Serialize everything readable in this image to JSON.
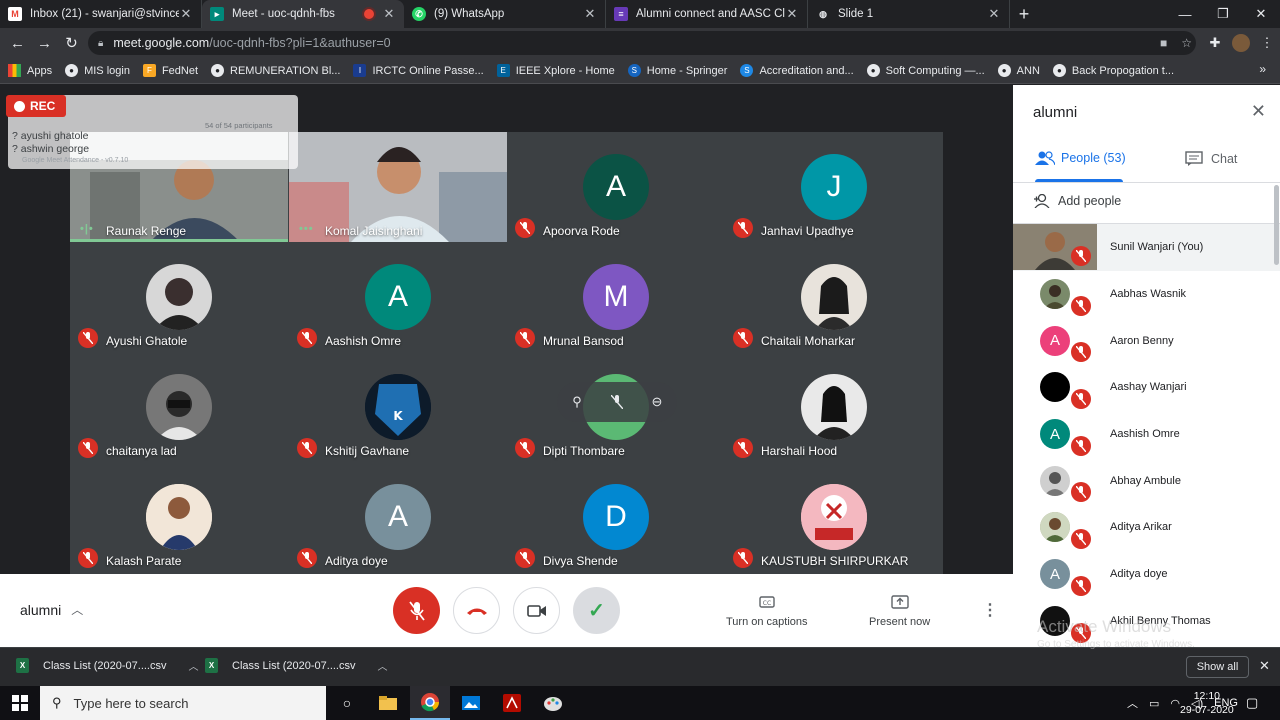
{
  "browser": {
    "tabs": [
      {
        "title": "Inbox (21) - swanjari@stvincentn",
        "icon": "gmail-icon",
        "active": false
      },
      {
        "title": "Meet - uoc-qdnh-fbs",
        "icon": "meet-icon",
        "active": true,
        "recording": true
      },
      {
        "title": "(9) WhatsApp",
        "icon": "whatsapp-icon",
        "active": false
      },
      {
        "title": "Alumni connect and AASC Club",
        "icon": "forms-icon",
        "active": false
      },
      {
        "title": "Slide 1",
        "icon": "globe-icon",
        "active": false
      }
    ],
    "url_host": "meet.google.com",
    "url_path": "/uoc-qdnh-fbs?pli=1&authuser=0",
    "bookmarks": [
      {
        "label": "Apps",
        "icon": "apps-grid-icon"
      },
      {
        "label": "MIS login",
        "icon": "globe-icon"
      },
      {
        "label": "FedNet",
        "icon": "fednet-icon"
      },
      {
        "label": "REMUNERATION Bl...",
        "icon": "globe-icon"
      },
      {
        "label": "IRCTC Online Passe...",
        "icon": "irctc-icon"
      },
      {
        "label": "IEEE Xplore - Home",
        "icon": "ieee-icon"
      },
      {
        "label": "Home - Springer",
        "icon": "springer-icon"
      },
      {
        "label": "Accreditation and...",
        "icon": "s-icon"
      },
      {
        "label": "Soft Computing —...",
        "icon": "globe-icon"
      },
      {
        "label": "ANN",
        "icon": "globe-icon"
      },
      {
        "label": "Back Propogation t...",
        "icon": "globe-icon"
      }
    ]
  },
  "overlay": {
    "rec_label": "REC",
    "attendance_names": [
      "? ayushi ghatole",
      "? ashwin george"
    ],
    "attendance_count": "54 of 54 participants",
    "attendance_footer": "Google Meet Attendance - v0.7.10"
  },
  "tiles": [
    {
      "name": "Raunak Renge",
      "kind": "video",
      "speaking": true
    },
    {
      "name": "Komal Jaisinghani",
      "kind": "video",
      "speaking": true
    },
    {
      "name": "Apoorva Rode",
      "kind": "letter",
      "letter": "A",
      "color": "#0b5345"
    },
    {
      "name": "Janhavi Upadhye",
      "kind": "letter",
      "letter": "J",
      "color": "#0097a7"
    },
    {
      "name": "Ayushi Ghatole",
      "kind": "photo",
      "color": "#d7d7d7"
    },
    {
      "name": "Aashish Omre",
      "kind": "letter",
      "letter": "A",
      "color": "#00897b"
    },
    {
      "name": "Mrunal Bansod",
      "kind": "letter",
      "letter": "M",
      "color": "#7e57c2"
    },
    {
      "name": "Chaitali Moharkar",
      "kind": "photo",
      "color": "#e8e3dc"
    },
    {
      "name": "chaitanya lad",
      "kind": "photo",
      "color": "#4a4a4a"
    },
    {
      "name": "Kshitij Gavhane",
      "kind": "photo",
      "color": "#0d1b2a"
    },
    {
      "name": "Dipti Thombare",
      "kind": "hover",
      "color": "#5bb974"
    },
    {
      "name": "Harshali Hood",
      "kind": "photo",
      "color": "#1c1c1c"
    },
    {
      "name": "Kalash Parate",
      "kind": "photo",
      "color": "#f2e6d8"
    },
    {
      "name": "Aditya doye",
      "kind": "letter",
      "letter": "A",
      "color": "#78909c"
    },
    {
      "name": "Divya Shende",
      "kind": "letter",
      "letter": "D",
      "color": "#0288d1"
    },
    {
      "name": "KAUSTUBH SHIRPURKAR",
      "kind": "photo",
      "color": "#f4b8c0"
    }
  ],
  "panel": {
    "title": "alumni",
    "people_tab": "People (53)",
    "chat_tab": "Chat",
    "add_people": "Add people",
    "people": [
      {
        "name": "Sunil Wanjari (You)",
        "self": true
      },
      {
        "name": "Aabhas Wasnik",
        "avatar": "photo",
        "color": "#7a8a6a"
      },
      {
        "name": "Aaron Benny",
        "avatar": "letter",
        "letter": "A",
        "color": "#ec407a"
      },
      {
        "name": "Aashay Wanjari",
        "avatar": "letter",
        "letter": "",
        "color": "#000000"
      },
      {
        "name": "Aashish Omre",
        "avatar": "letter",
        "letter": "A",
        "color": "#00897b"
      },
      {
        "name": "Abhay Ambule",
        "avatar": "photo",
        "color": "#cfcfcf"
      },
      {
        "name": "Aditya Arikar",
        "avatar": "photo",
        "color": "#9a9a7a"
      },
      {
        "name": "Aditya doye",
        "avatar": "letter",
        "letter": "A",
        "color": "#78909c"
      },
      {
        "name": "Akhil Benny Thomas",
        "avatar": "letter",
        "letter": "",
        "color": "#111111"
      }
    ],
    "watermark_title": "Activate Windows",
    "watermark_sub": "Go to Settings to activate Windows."
  },
  "meetbar": {
    "meeting_name": "alumni",
    "captions_label": "Turn on captions",
    "present_label": "Present now"
  },
  "downloads": [
    {
      "name": "Class List (2020-07....csv"
    },
    {
      "name": "Class List (2020-07....csv"
    }
  ],
  "downloads_show_all": "Show all",
  "taskbar": {
    "search_placeholder": "Type here to search",
    "lang": "ENG",
    "time": "12:10",
    "date": "29-07-2020"
  }
}
